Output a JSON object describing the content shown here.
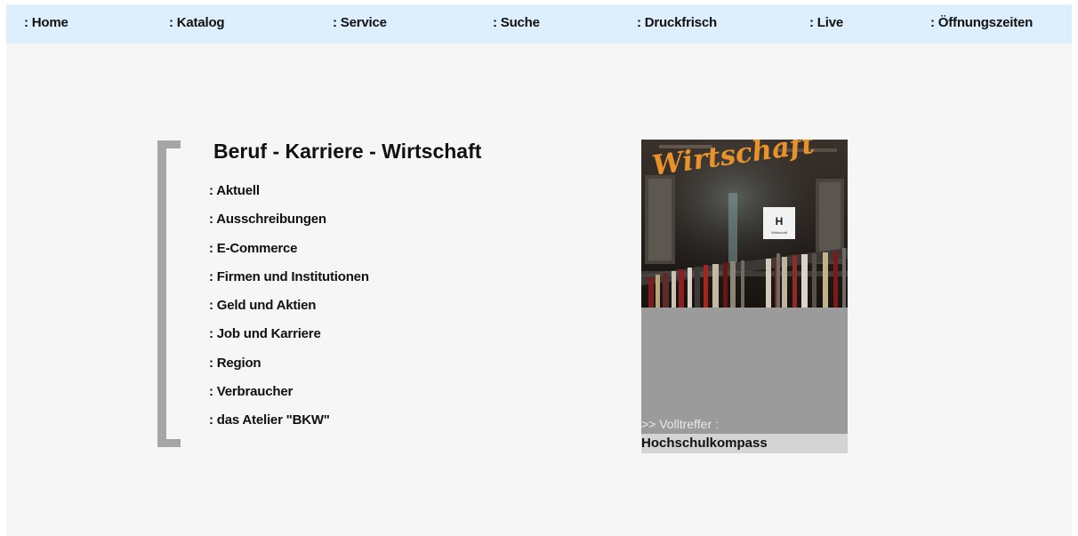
{
  "nav": {
    "items": [
      {
        "label": ": Home"
      },
      {
        "label": ": Katalog"
      },
      {
        "label": ": Service"
      },
      {
        "label": ": Suche"
      },
      {
        "label": ": Druckfrisch"
      },
      {
        "label": ": Live"
      },
      {
        "label": ": Öffnungszeiten"
      }
    ]
  },
  "main": {
    "title": "Beruf - Karriere - Wirtschaft",
    "categories": [
      {
        "label": ": Aktuell"
      },
      {
        "label": ": Ausschreibungen"
      },
      {
        "label": ": E-Commerce"
      },
      {
        "label": ": Firmen und Institutionen"
      },
      {
        "label": ": Geld und Aktien"
      },
      {
        "label": ": Job und Karriere"
      },
      {
        "label": ": Region"
      },
      {
        "label": ": Verbraucher"
      },
      {
        "label": ": das Atelier \"BKW\""
      }
    ]
  },
  "promo": {
    "image_script_text": "Wirtschaft",
    "sign_letter": "H",
    "sign_text": "Wirtschaft",
    "caption": ">> Volltreffer :",
    "link_label": "Hochschulkompass"
  },
  "colors": {
    "nav_background": "#ddeefc",
    "page_background": "#f6f6f6",
    "bracket": "#a6a6a6",
    "promo_panel": "#9b9b9b",
    "script_orange": "#e8922c"
  }
}
